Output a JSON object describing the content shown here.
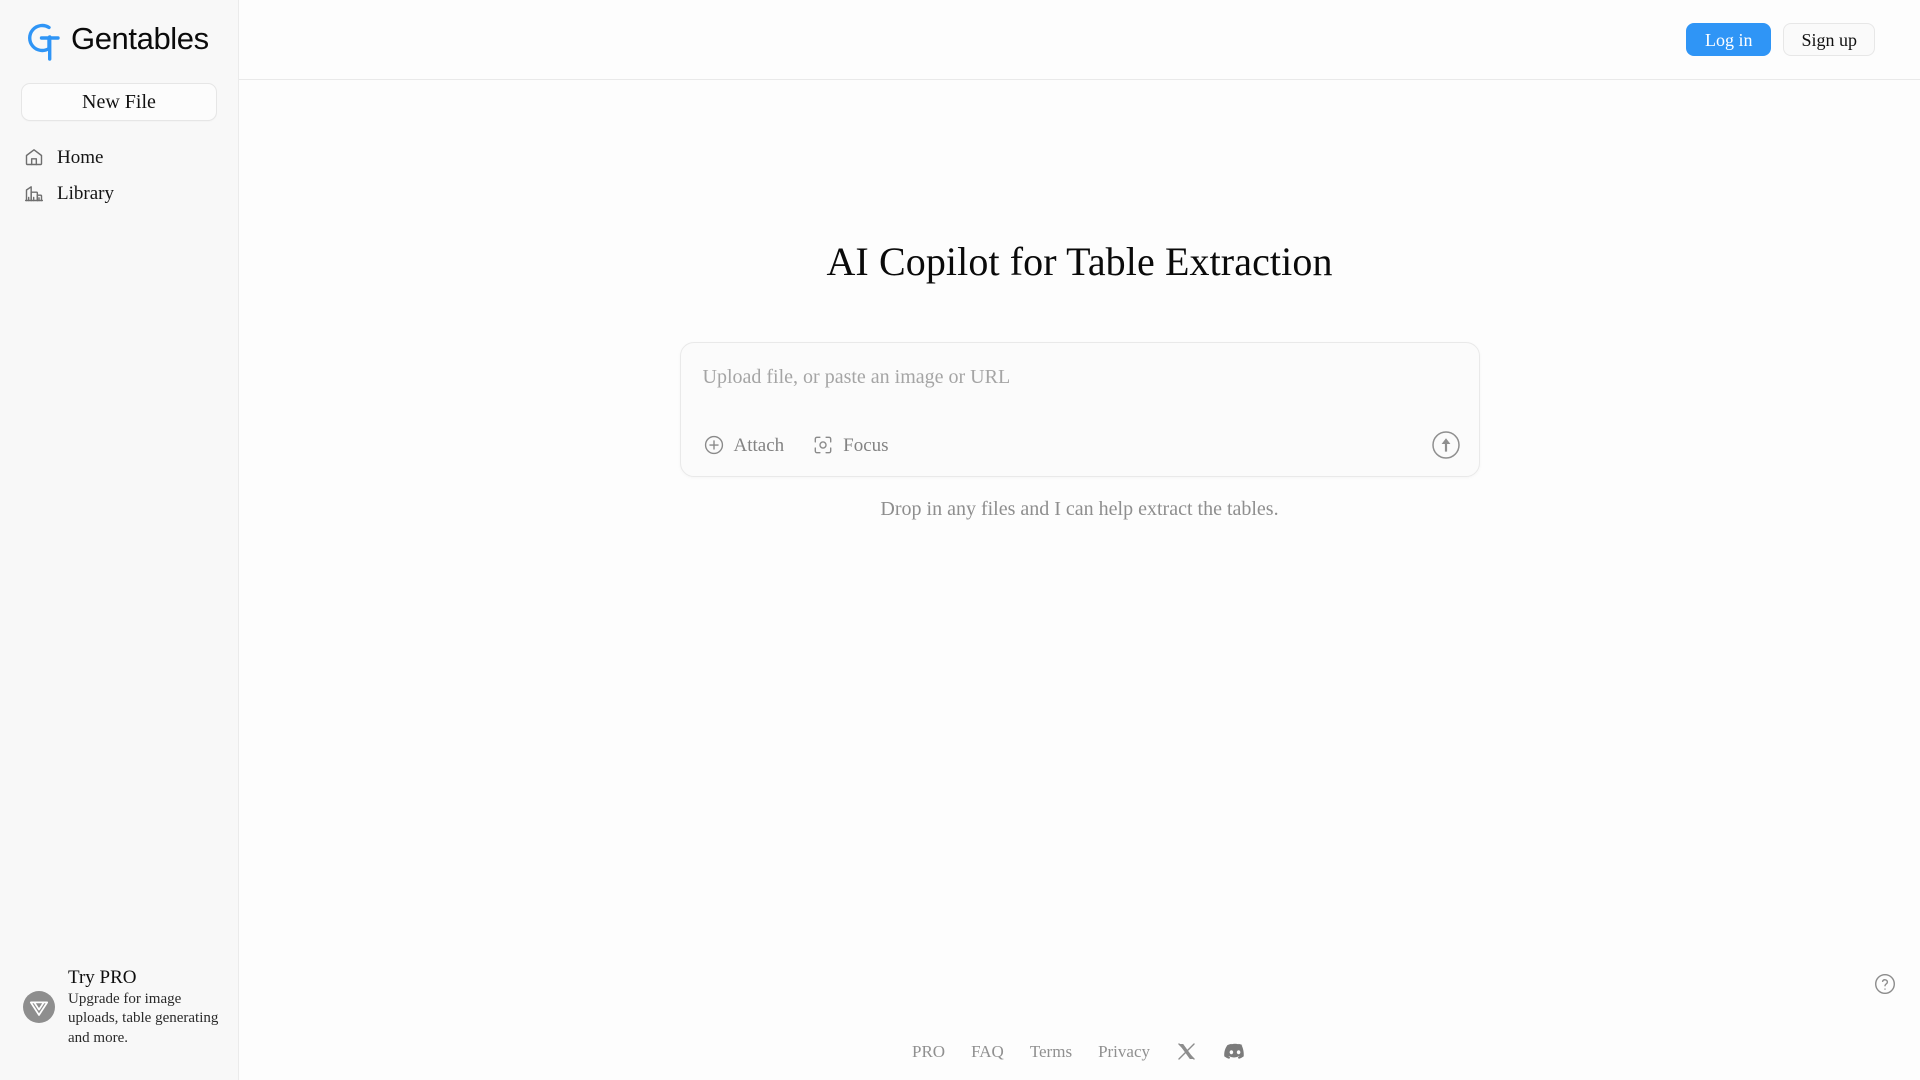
{
  "brand": {
    "name": "Gentables",
    "logo_icon": "gt-monogram-logo",
    "logo_color": "#2f95f6"
  },
  "sidebar": {
    "new_file_label": "New File",
    "items": [
      {
        "label": "Home",
        "icon": "home-icon"
      },
      {
        "label": "Library",
        "icon": "library-bar-chart-icon"
      }
    ],
    "promo": {
      "icon": "pro-chevron-badge-icon",
      "title": "Try PRO",
      "subtitle": "Upgrade for image uploads, table generating and more."
    }
  },
  "topbar": {
    "login_label": "Log in",
    "signup_label": "Sign up",
    "login_color": "#2f95f6"
  },
  "main": {
    "title": "AI Copilot for Table Extraction",
    "subtitle": "Drop in any files and I can help extract the tables.",
    "composer": {
      "placeholder": "Upload file, or paste an image or URL",
      "value": "",
      "attach_label": "Attach",
      "attach_icon": "plus-circle-icon",
      "focus_label": "Focus",
      "focus_icon": "focus-scan-icon",
      "submit_icon": "arrow-up-circle-icon"
    }
  },
  "footer": {
    "links": [
      {
        "label": "PRO"
      },
      {
        "label": "FAQ"
      },
      {
        "label": "Terms"
      },
      {
        "label": "Privacy"
      }
    ],
    "social": [
      {
        "name": "x-twitter-icon"
      },
      {
        "name": "discord-icon"
      }
    ]
  },
  "help": {
    "icon": "question-mark-circle-icon"
  }
}
